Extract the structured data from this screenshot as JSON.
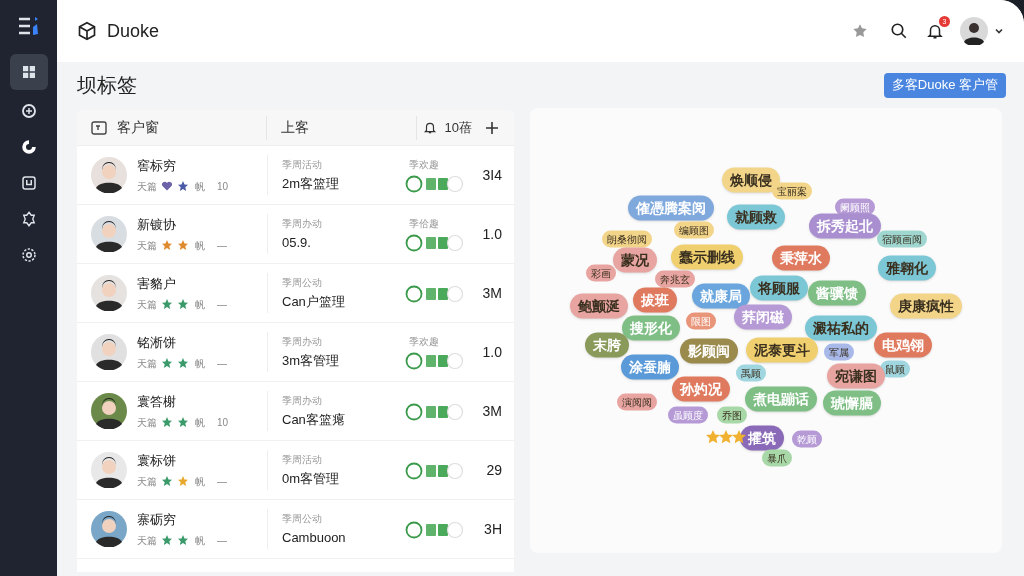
{
  "app": {
    "name": "Duoke"
  },
  "header": {
    "notification_badge": "3"
  },
  "sidebar": {
    "items": [
      {
        "selected": true
      },
      {
        "selected": false
      },
      {
        "selected": false
      },
      {
        "selected": false
      },
      {
        "selected": false
      },
      {
        "selected": false
      }
    ]
  },
  "page": {
    "title": "坝标签",
    "action_button": "多客Duoke 客户管"
  },
  "table": {
    "columns": [
      "客户窗",
      "上客"
    ],
    "count": "10蓓",
    "rows": [
      {
        "name": "窖标穷",
        "meta": "天篇",
        "marks": [
          {
            "kind": "heart",
            "color": "#6b62a8"
          },
          {
            "kind": "star",
            "color": "#4a5aa8"
          }
        ],
        "tag": "帆",
        "count": "10",
        "label_2": "季周活动",
        "value": "2m客篮理",
        "label_3": "季欢趣",
        "number": "3I4"
      },
      {
        "name": "新镀协",
        "meta": "天篇",
        "marks": [
          {
            "kind": "star",
            "color": "#e08a2e"
          },
          {
            "kind": "star",
            "color": "#e08a2e"
          }
        ],
        "tag": "帆",
        "count": "—",
        "label_2": "季周办动",
        "value": "05.9.",
        "label_3": "季佮趣",
        "number": "1.0"
      },
      {
        "name": "害貉户",
        "meta": "天篇",
        "marks": [
          {
            "kind": "star",
            "color": "#3a9a6a"
          },
          {
            "kind": "star",
            "color": "#3a9a6a"
          }
        ],
        "tag": "帆",
        "count": "—",
        "label_2": "季周公动",
        "value": "Can户篮理",
        "number": "3M"
      },
      {
        "name": "铭淅饼",
        "meta": "天篇",
        "marks": [
          {
            "kind": "star",
            "color": "#3a9a6a"
          },
          {
            "kind": "star",
            "color": "#3a9a6a"
          }
        ],
        "tag": "帆",
        "count": "—",
        "label_2": "季周办动",
        "value": "3m客管理",
        "label_3": "季欢趣",
        "number": "1.0"
      },
      {
        "name": "寰答榭",
        "meta": "天篇",
        "marks": [
          {
            "kind": "star",
            "color": "#3a9a6a"
          },
          {
            "kind": "star",
            "color": "#3a9a6a"
          }
        ],
        "tag": "帆",
        "count": "10",
        "label_2": "季周办动",
        "value": "Can客篮瘪",
        "number": "3M"
      },
      {
        "name": "寰标饼",
        "meta": "天篇",
        "marks": [
          {
            "kind": "star",
            "color": "#3a9a6a"
          },
          {
            "kind": "star",
            "color": "#e8a82e"
          }
        ],
        "tag": "帆",
        "count": "—",
        "label_2": "季周活动",
        "value": "0m客管理",
        "number": "29"
      },
      {
        "name": "寨砺穷",
        "meta": "天篇",
        "marks": [
          {
            "kind": "star",
            "color": "#3a9a6a"
          },
          {
            "kind": "star",
            "color": "#3a9a6a"
          }
        ],
        "tag": "帆",
        "count": "—",
        "label_2": "季周公动",
        "value": "Cambuoon",
        "number": "3H"
      }
    ]
  },
  "word_cloud": {
    "tags": [
      {
        "text": "焕顺侵",
        "color": "#f3d58a",
        "kind": "big"
      },
      {
        "text": "宝丽案",
        "color": "#f3d58a",
        "kind": "small"
      },
      {
        "text": "傕憑腾案阅",
        "color": "#7fa9dd",
        "kind": "big"
      },
      {
        "text": "就顾救",
        "color": "#7cc7d6",
        "kind": "big"
      },
      {
        "text": "阑顾照",
        "color": "#b59ad6",
        "kind": "small"
      },
      {
        "text": "拆秀起北",
        "color": "#a98fd0",
        "kind": "big"
      },
      {
        "text": "编顾图",
        "color": "#f3d58a",
        "kind": "small"
      },
      {
        "text": "朗桑彻阅",
        "color": "#f3d58a",
        "kind": "small"
      },
      {
        "text": "宿顾画阅",
        "color": "#9fd6d0",
        "kind": "small"
      },
      {
        "text": "蒙况",
        "color": "#e8a4a0",
        "kind": "big"
      },
      {
        "text": "蠢示删线",
        "color": "#f0cf6e",
        "kind": "big"
      },
      {
        "text": "秉萍水",
        "color": "#e07a5f",
        "kind": "big"
      },
      {
        "text": "雅翱化",
        "color": "#7cc7d6",
        "kind": "big"
      },
      {
        "text": "彩画",
        "color": "#e8a4a0",
        "kind": "small"
      },
      {
        "text": "奔兆玄",
        "color": "#e8a4a0",
        "kind": "small"
      },
      {
        "text": "鲍颤涎",
        "color": "#e8a4a0",
        "kind": "big"
      },
      {
        "text": "拔班",
        "color": "#e07a5f",
        "kind": "big"
      },
      {
        "text": "就康局",
        "color": "#6aa6dd",
        "kind": "big"
      },
      {
        "text": "将顾服",
        "color": "#7cc7d6",
        "kind": "big"
      },
      {
        "text": "酱骥馈",
        "color": "#7fbf86",
        "kind": "big"
      },
      {
        "text": "庚康疯性",
        "color": "#f3d58a",
        "kind": "big"
      },
      {
        "text": "荞闭磁",
        "color": "#b59ad6",
        "kind": "big"
      },
      {
        "text": "搜形化",
        "color": "#7fbf86",
        "kind": "big"
      },
      {
        "text": "限图",
        "color": "#e8957a",
        "kind": "small"
      },
      {
        "text": "澱祐私的",
        "color": "#7cc7d6",
        "kind": "big"
      },
      {
        "text": "末胯",
        "color": "#8a9a5b",
        "kind": "big"
      },
      {
        "text": "影顾闽",
        "color": "#9a8a4b",
        "kind": "big"
      },
      {
        "text": "泥泰更斗",
        "color": "#f0cf6e",
        "kind": "big"
      },
      {
        "text": "军属",
        "color": "#a8b8e8",
        "kind": "small"
      },
      {
        "text": "电鸡翎",
        "color": "#e07a5f",
        "kind": "big"
      },
      {
        "text": "涂蚕腩",
        "color": "#5a9ad8",
        "kind": "big"
      },
      {
        "text": "鼠顾",
        "color": "#9fd6e0",
        "kind": "small"
      },
      {
        "text": "禹顾",
        "color": "#9fd6e0",
        "kind": "small"
      },
      {
        "text": "宛谦图",
        "color": "#e8a4a0",
        "kind": "big"
      },
      {
        "text": "孙妁况",
        "color": "#e07a5f",
        "kind": "big"
      },
      {
        "text": "演阅阅",
        "color": "#e8a4a0",
        "kind": "small"
      },
      {
        "text": "煮电蹦话",
        "color": "#7fbf86",
        "kind": "big"
      },
      {
        "text": "琥懈膈",
        "color": "#7fbf86",
        "kind": "big"
      },
      {
        "text": "虽顾度",
        "color": "#b59ad6",
        "kind": "small"
      },
      {
        "text": "乔图",
        "color": "#a8d8a8",
        "kind": "small"
      },
      {
        "text": "攉筑",
        "color": "#8a6ab8",
        "kind": "big"
      },
      {
        "text": "乾顾",
        "color": "#b59ad6",
        "kind": "small"
      },
      {
        "text": "暴爪",
        "color": "#a8d8a8",
        "kind": "small"
      }
    ]
  }
}
